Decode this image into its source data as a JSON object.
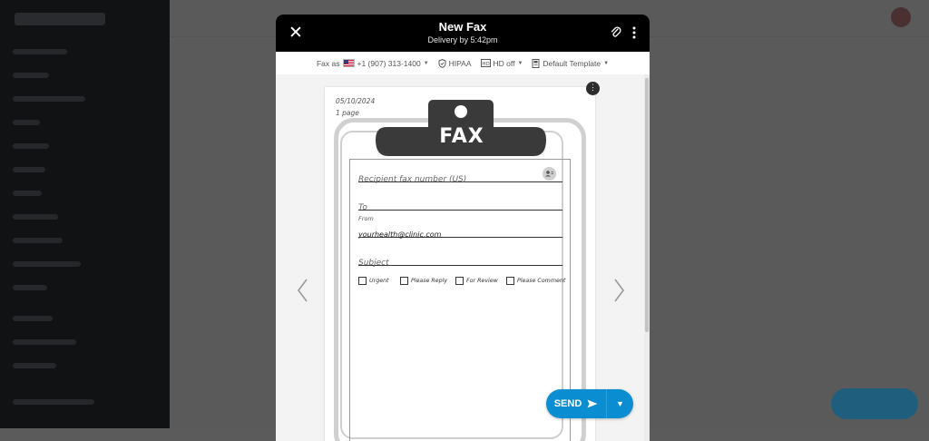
{
  "modal": {
    "title": "New Fax",
    "subtitle": "Delivery by 5:42pm"
  },
  "options": {
    "fax_as_label": "Fax as",
    "fax_as_number": "+1 (907) 313-1400",
    "hipaa_label": "HIPAA",
    "hd_label": "HD off",
    "template_label": "Default Template"
  },
  "page": {
    "date": "05/10/2024",
    "page_count": "1 page",
    "header_word": "FAX",
    "recipient_placeholder": "Recipient fax number (US)",
    "to_label": "To",
    "from_label": "From",
    "from_value": "yourhealth@clinic.com",
    "subject_label": "Subject",
    "checkboxes": [
      "Urgent",
      "Please Reply",
      "For Review",
      "Please Comment"
    ]
  },
  "send": {
    "label": "SEND"
  },
  "icons": {
    "close": "close-icon",
    "attach": "paperclip-icon",
    "more": "more-vertical-icon",
    "flag": "us-flag-icon",
    "hipaa": "shield-icon",
    "hd": "hd-icon",
    "template": "document-icon",
    "prev": "chevron-left-icon",
    "next": "chevron-right-icon",
    "contacts": "contacts-icon",
    "send": "send-icon",
    "dropdown": "caret-down-icon"
  },
  "colors": {
    "header_bg": "#000000",
    "accent": "#0b8ed1"
  }
}
